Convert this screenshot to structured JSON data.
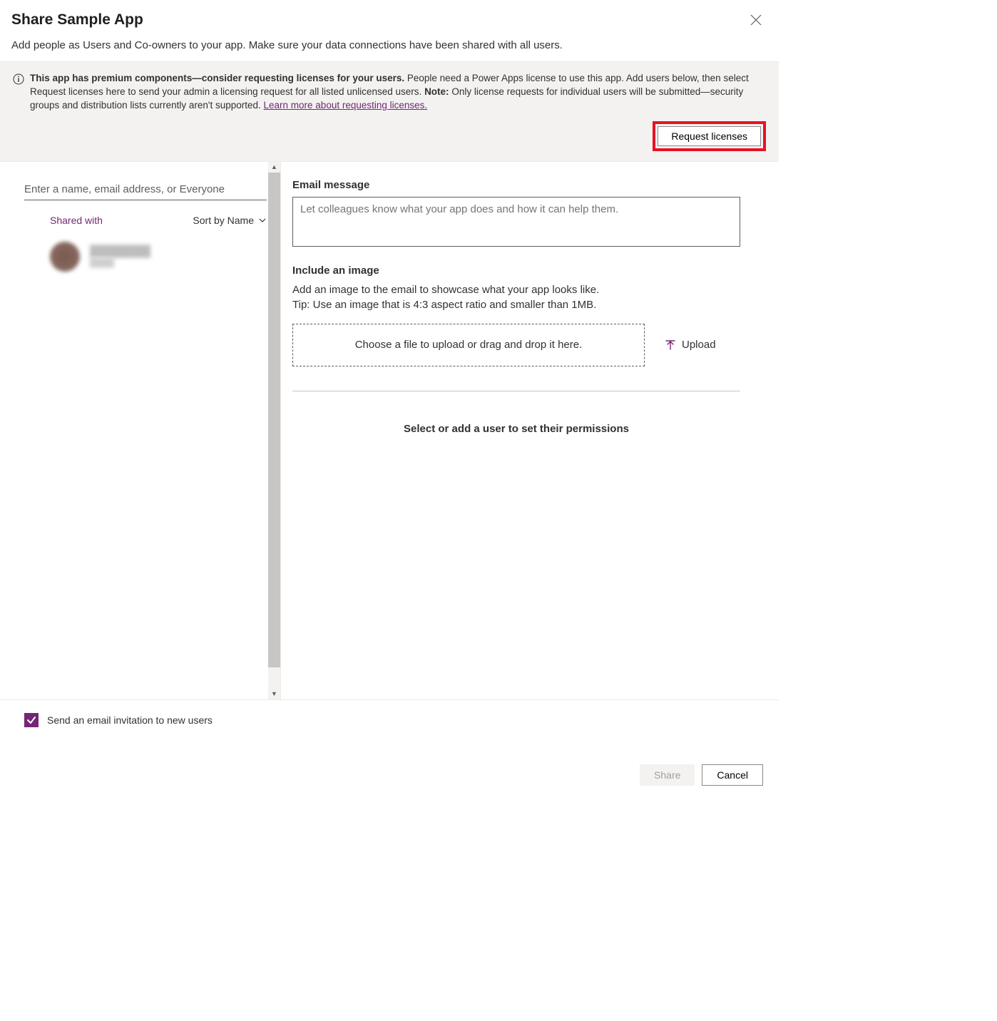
{
  "header": {
    "title": "Share Sample App",
    "subtitle": "Add people as Users and Co-owners to your app. Make sure your data connections have been shared with all users."
  },
  "banner": {
    "bold_lead": "This app has premium components—consider requesting licenses for your users.",
    "body_1": " People need a Power Apps license to use this app. Add users below, then select Request licenses here to send your admin a licensing request for all listed unlicensed users. ",
    "note_label": "Note:",
    "body_2": " Only license requests for individual users will be submitted—security groups and distribution lists currently aren't supported. ",
    "link_text": "Learn more about requesting licenses.",
    "request_button": "Request licenses"
  },
  "left": {
    "search_placeholder": "Enter a name, email address, or Everyone",
    "shared_with_label": "Shared with",
    "sort_label": "Sort by Name"
  },
  "right": {
    "email_label": "Email message",
    "email_placeholder": "Let colleagues know what your app does and how it can help them.",
    "image_label": "Include an image",
    "image_desc_1": "Add an image to the email to showcase what your app looks like.",
    "image_desc_2": "Tip: Use an image that is 4:3 aspect ratio and smaller than 1MB.",
    "dropzone_text": "Choose a file to upload or drag and drop it here.",
    "upload_label": "Upload",
    "prompt": "Select or add a user to set their permissions"
  },
  "checkbox": {
    "label": "Send an email invitation to new users"
  },
  "footer": {
    "share": "Share",
    "cancel": "Cancel"
  }
}
